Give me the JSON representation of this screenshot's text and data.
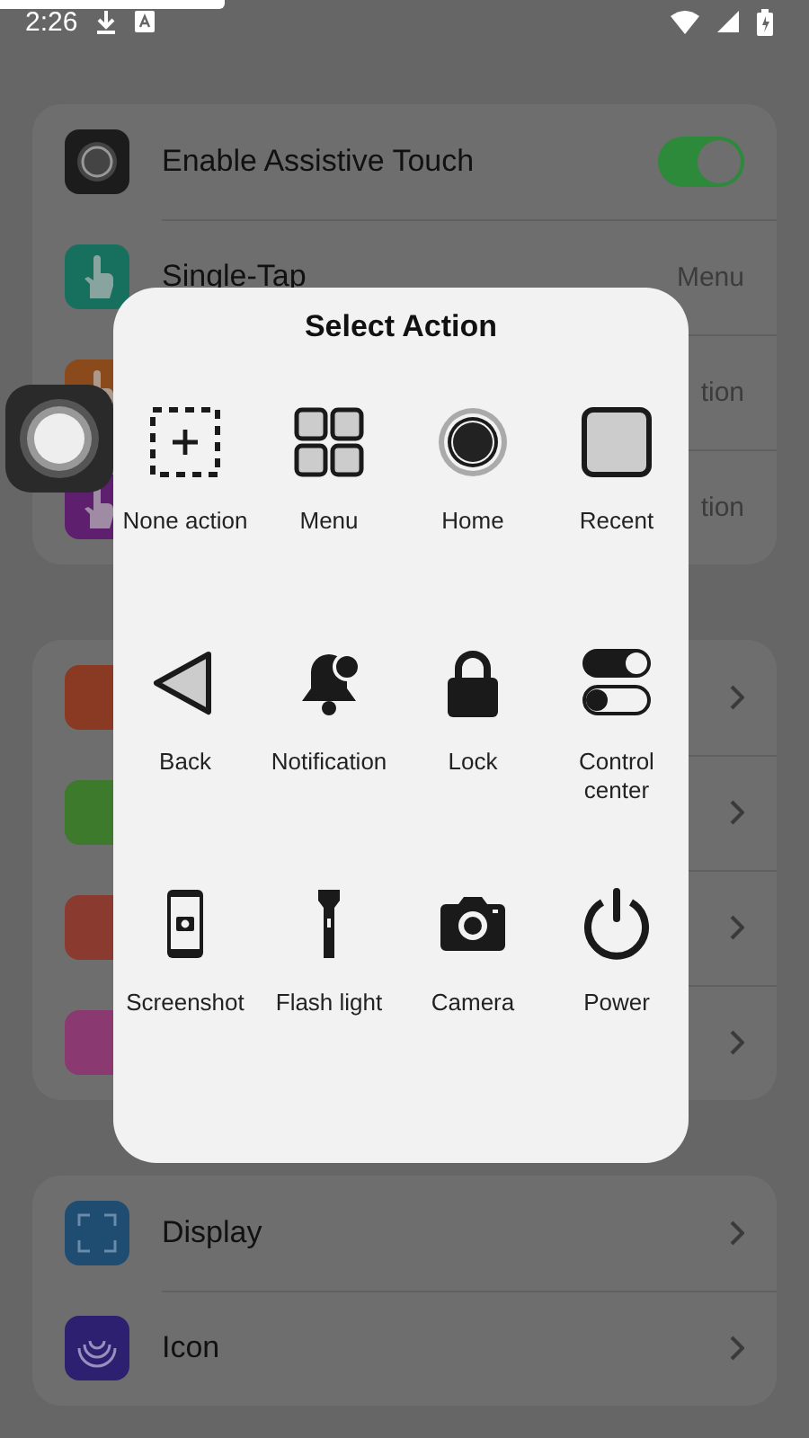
{
  "status_bar": {
    "time": "2:26"
  },
  "gesture_settings": [
    {
      "kind": "toggle",
      "label": "Enable Assistive Touch",
      "on": true,
      "color": "#1c1c1c"
    },
    {
      "kind": "value",
      "label": "Single-Tap",
      "value": "Menu",
      "color": "#17705e"
    },
    {
      "kind": "value",
      "value": "tion",
      "color": "#8a4a1c"
    },
    {
      "kind": "value",
      "value": "tion",
      "color": "#5e1f6e"
    }
  ],
  "custom_settings": [
    {
      "color": "#8a3a22"
    },
    {
      "color": "#3e7a2c"
    },
    {
      "color": "#8b3a30"
    },
    {
      "color": "#8a3a70"
    }
  ],
  "appearance_settings": [
    {
      "label": "Display",
      "color": "#1f4d72"
    },
    {
      "label": "Icon",
      "color": "#2e2070"
    }
  ],
  "dialog": {
    "title": "Select Action",
    "actions": [
      {
        "kind": "none",
        "label": "None action"
      },
      {
        "kind": "menu",
        "label": "Menu"
      },
      {
        "kind": "home",
        "label": "Home"
      },
      {
        "kind": "recent",
        "label": "Recent"
      },
      {
        "kind": "back",
        "label": "Back"
      },
      {
        "kind": "notification",
        "label": "Notification"
      },
      {
        "kind": "lock",
        "label": "Lock"
      },
      {
        "kind": "control",
        "label": "Control center"
      },
      {
        "kind": "screenshot",
        "label": "Screenshot"
      },
      {
        "kind": "flashlight",
        "label": "Flash light"
      },
      {
        "kind": "camera",
        "label": "Camera"
      },
      {
        "kind": "power",
        "label": "Power"
      }
    ]
  }
}
